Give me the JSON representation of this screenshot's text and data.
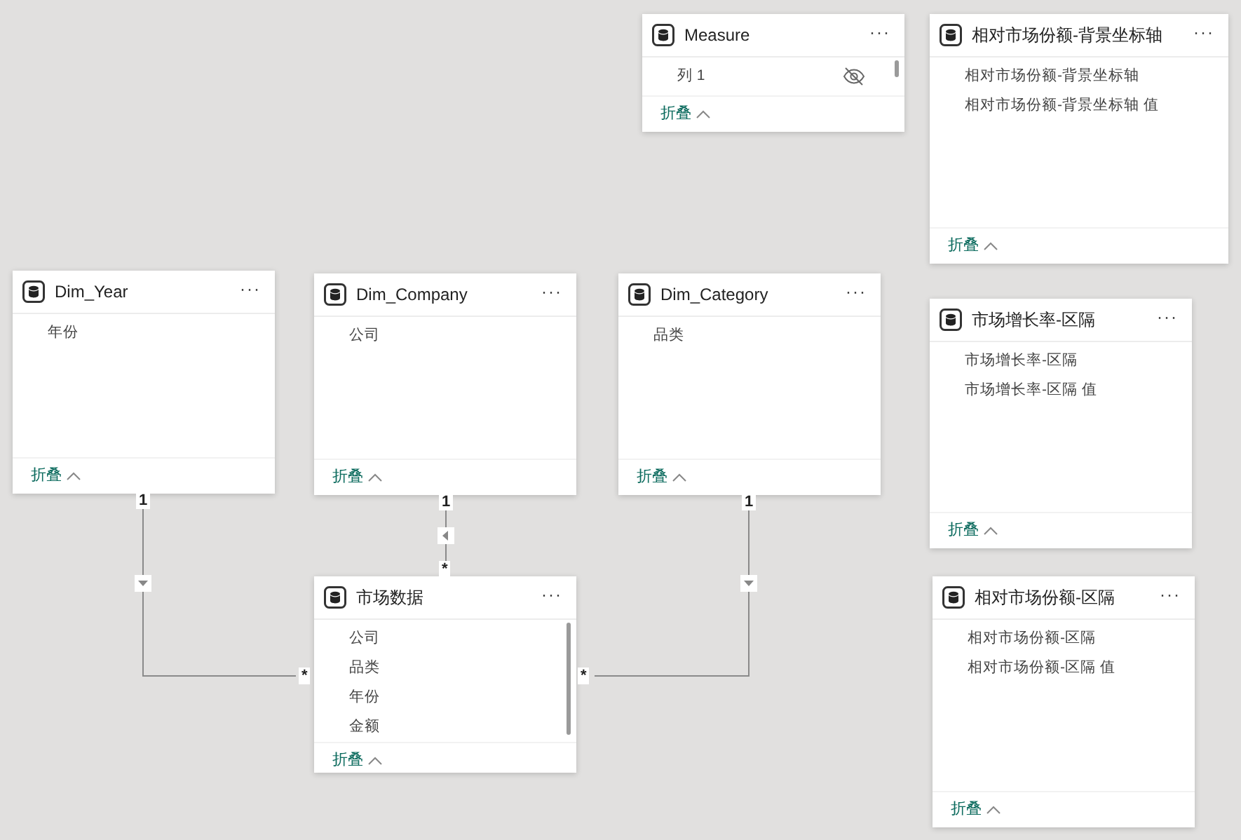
{
  "tables": [
    {
      "title": "Measure",
      "menu_label": "···",
      "fields": [
        {
          "name": "列 1",
          "hidden": true
        }
      ],
      "scrollbar": true,
      "collapse_label": "折叠"
    },
    {
      "title": "相对市场份额-背景坐标轴",
      "menu_label": "···",
      "fields": [
        {
          "name": "相对市场份额-背景坐标轴",
          "hidden": false
        },
        {
          "name": "相对市场份额-背景坐标轴 值",
          "hidden": false
        }
      ],
      "scrollbar": false,
      "collapse_label": "折叠"
    },
    {
      "title": "Dim_Year",
      "menu_label": "···",
      "fields": [
        {
          "name": "年份",
          "hidden": false
        }
      ],
      "scrollbar": false,
      "collapse_label": "折叠"
    },
    {
      "title": "Dim_Company",
      "menu_label": "···",
      "fields": [
        {
          "name": "公司",
          "hidden": false
        }
      ],
      "scrollbar": false,
      "collapse_label": "折叠"
    },
    {
      "title": "Dim_Category",
      "menu_label": "···",
      "fields": [
        {
          "name": "品类",
          "hidden": false
        }
      ],
      "scrollbar": false,
      "collapse_label": "折叠"
    },
    {
      "title": "市场增长率-区隔",
      "menu_label": "···",
      "fields": [
        {
          "name": "市场增长率-区隔",
          "hidden": false
        },
        {
          "name": "市场增长率-区隔 值",
          "hidden": false
        }
      ],
      "scrollbar": false,
      "collapse_label": "折叠"
    },
    {
      "title": "市场数据",
      "menu_label": "···",
      "fields": [
        {
          "name": "公司",
          "hidden": false
        },
        {
          "name": "品类",
          "hidden": false
        },
        {
          "name": "年份",
          "hidden": false
        },
        {
          "name": "金额",
          "hidden": false
        }
      ],
      "scrollbar": true,
      "collapse_label": "折叠"
    },
    {
      "title": "相对市场份额-区隔",
      "menu_label": "···",
      "fields": [
        {
          "name": "相对市场份额-区隔",
          "hidden": false
        },
        {
          "name": "相对市场份额-区隔 值",
          "hidden": false
        }
      ],
      "scrollbar": false,
      "collapse_label": "折叠"
    }
  ],
  "relationships": [
    {
      "one_label": "1",
      "many_label": "*",
      "kind": "down"
    },
    {
      "one_label": "1",
      "many_label": "*",
      "kind": "left"
    },
    {
      "one_label": "1",
      "many_label": "*",
      "kind": "down"
    }
  ]
}
